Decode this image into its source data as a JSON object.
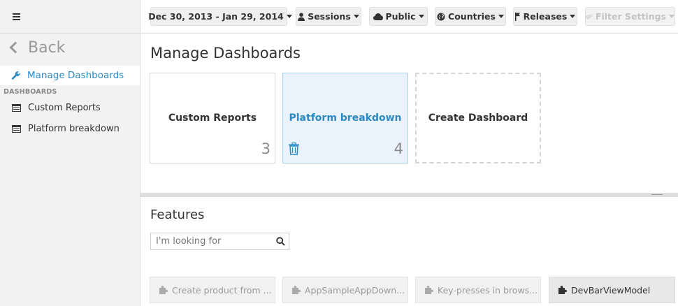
{
  "sidebar": {
    "back_label": "Back",
    "active_item": "Manage Dashboards",
    "section_label": "DASHBOARDS",
    "items": [
      {
        "label": "Custom Reports"
      },
      {
        "label": "Platform breakdown"
      }
    ]
  },
  "toolbar": {
    "date_range": "Dec 30, 2013 - Jan 29, 2014",
    "sessions": "Sessions",
    "public": "Public",
    "countries": "Countries",
    "releases": "Releases",
    "filter_settings": "Filter Settings"
  },
  "main": {
    "title": "Manage Dashboards",
    "cards": [
      {
        "title": "Custom Reports",
        "count": "3"
      },
      {
        "title": "Platform breakdown",
        "count": "4"
      },
      {
        "title": "Create Dashboard"
      }
    ]
  },
  "features": {
    "title": "Features",
    "search_placeholder": "I'm looking for",
    "items": [
      {
        "label": "Create product from ..."
      },
      {
        "label": "AppSampleAppDown..."
      },
      {
        "label": "Key-presses in brows..."
      },
      {
        "label": "DevBarViewModel"
      }
    ]
  },
  "colors": {
    "accent": "#2b8ac6",
    "sidebar_bg": "#f2f2f2",
    "active_card_bg": "#eaf3fb"
  }
}
